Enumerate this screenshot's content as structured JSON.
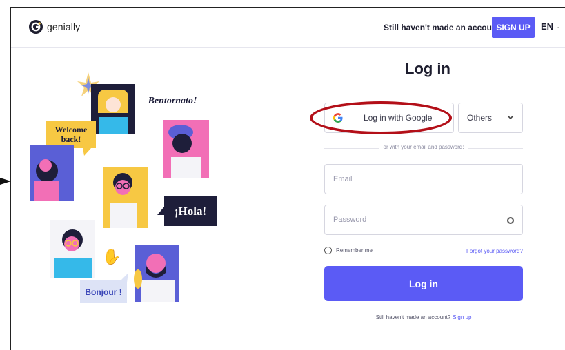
{
  "header": {
    "logo_text": "genially",
    "no_account_text": "Still haven't made an account?",
    "signup_label": "SIGN UP",
    "language": "EN"
  },
  "illustration": {
    "bubbles": {
      "bentornato": "Bentornato!",
      "welcome": "Welcome back!",
      "hola": "¡Hola!",
      "bonjour": "Bonjour !"
    }
  },
  "login": {
    "title": "Log in",
    "google_label": "Log in with Google",
    "others_label": "Others",
    "divider_text": "or with your email and password:",
    "email_placeholder": "Email",
    "password_placeholder": "Password",
    "remember_label": "Remember me",
    "forgot_label": "Forgot your password?",
    "submit_label": "Log in",
    "bottom_text": "Still haven't made an account?",
    "bottom_link": "Sign up"
  },
  "colors": {
    "accent": "#5b5bf5",
    "highlight_ring": "#b30f18",
    "text": "#1e1e2f"
  }
}
